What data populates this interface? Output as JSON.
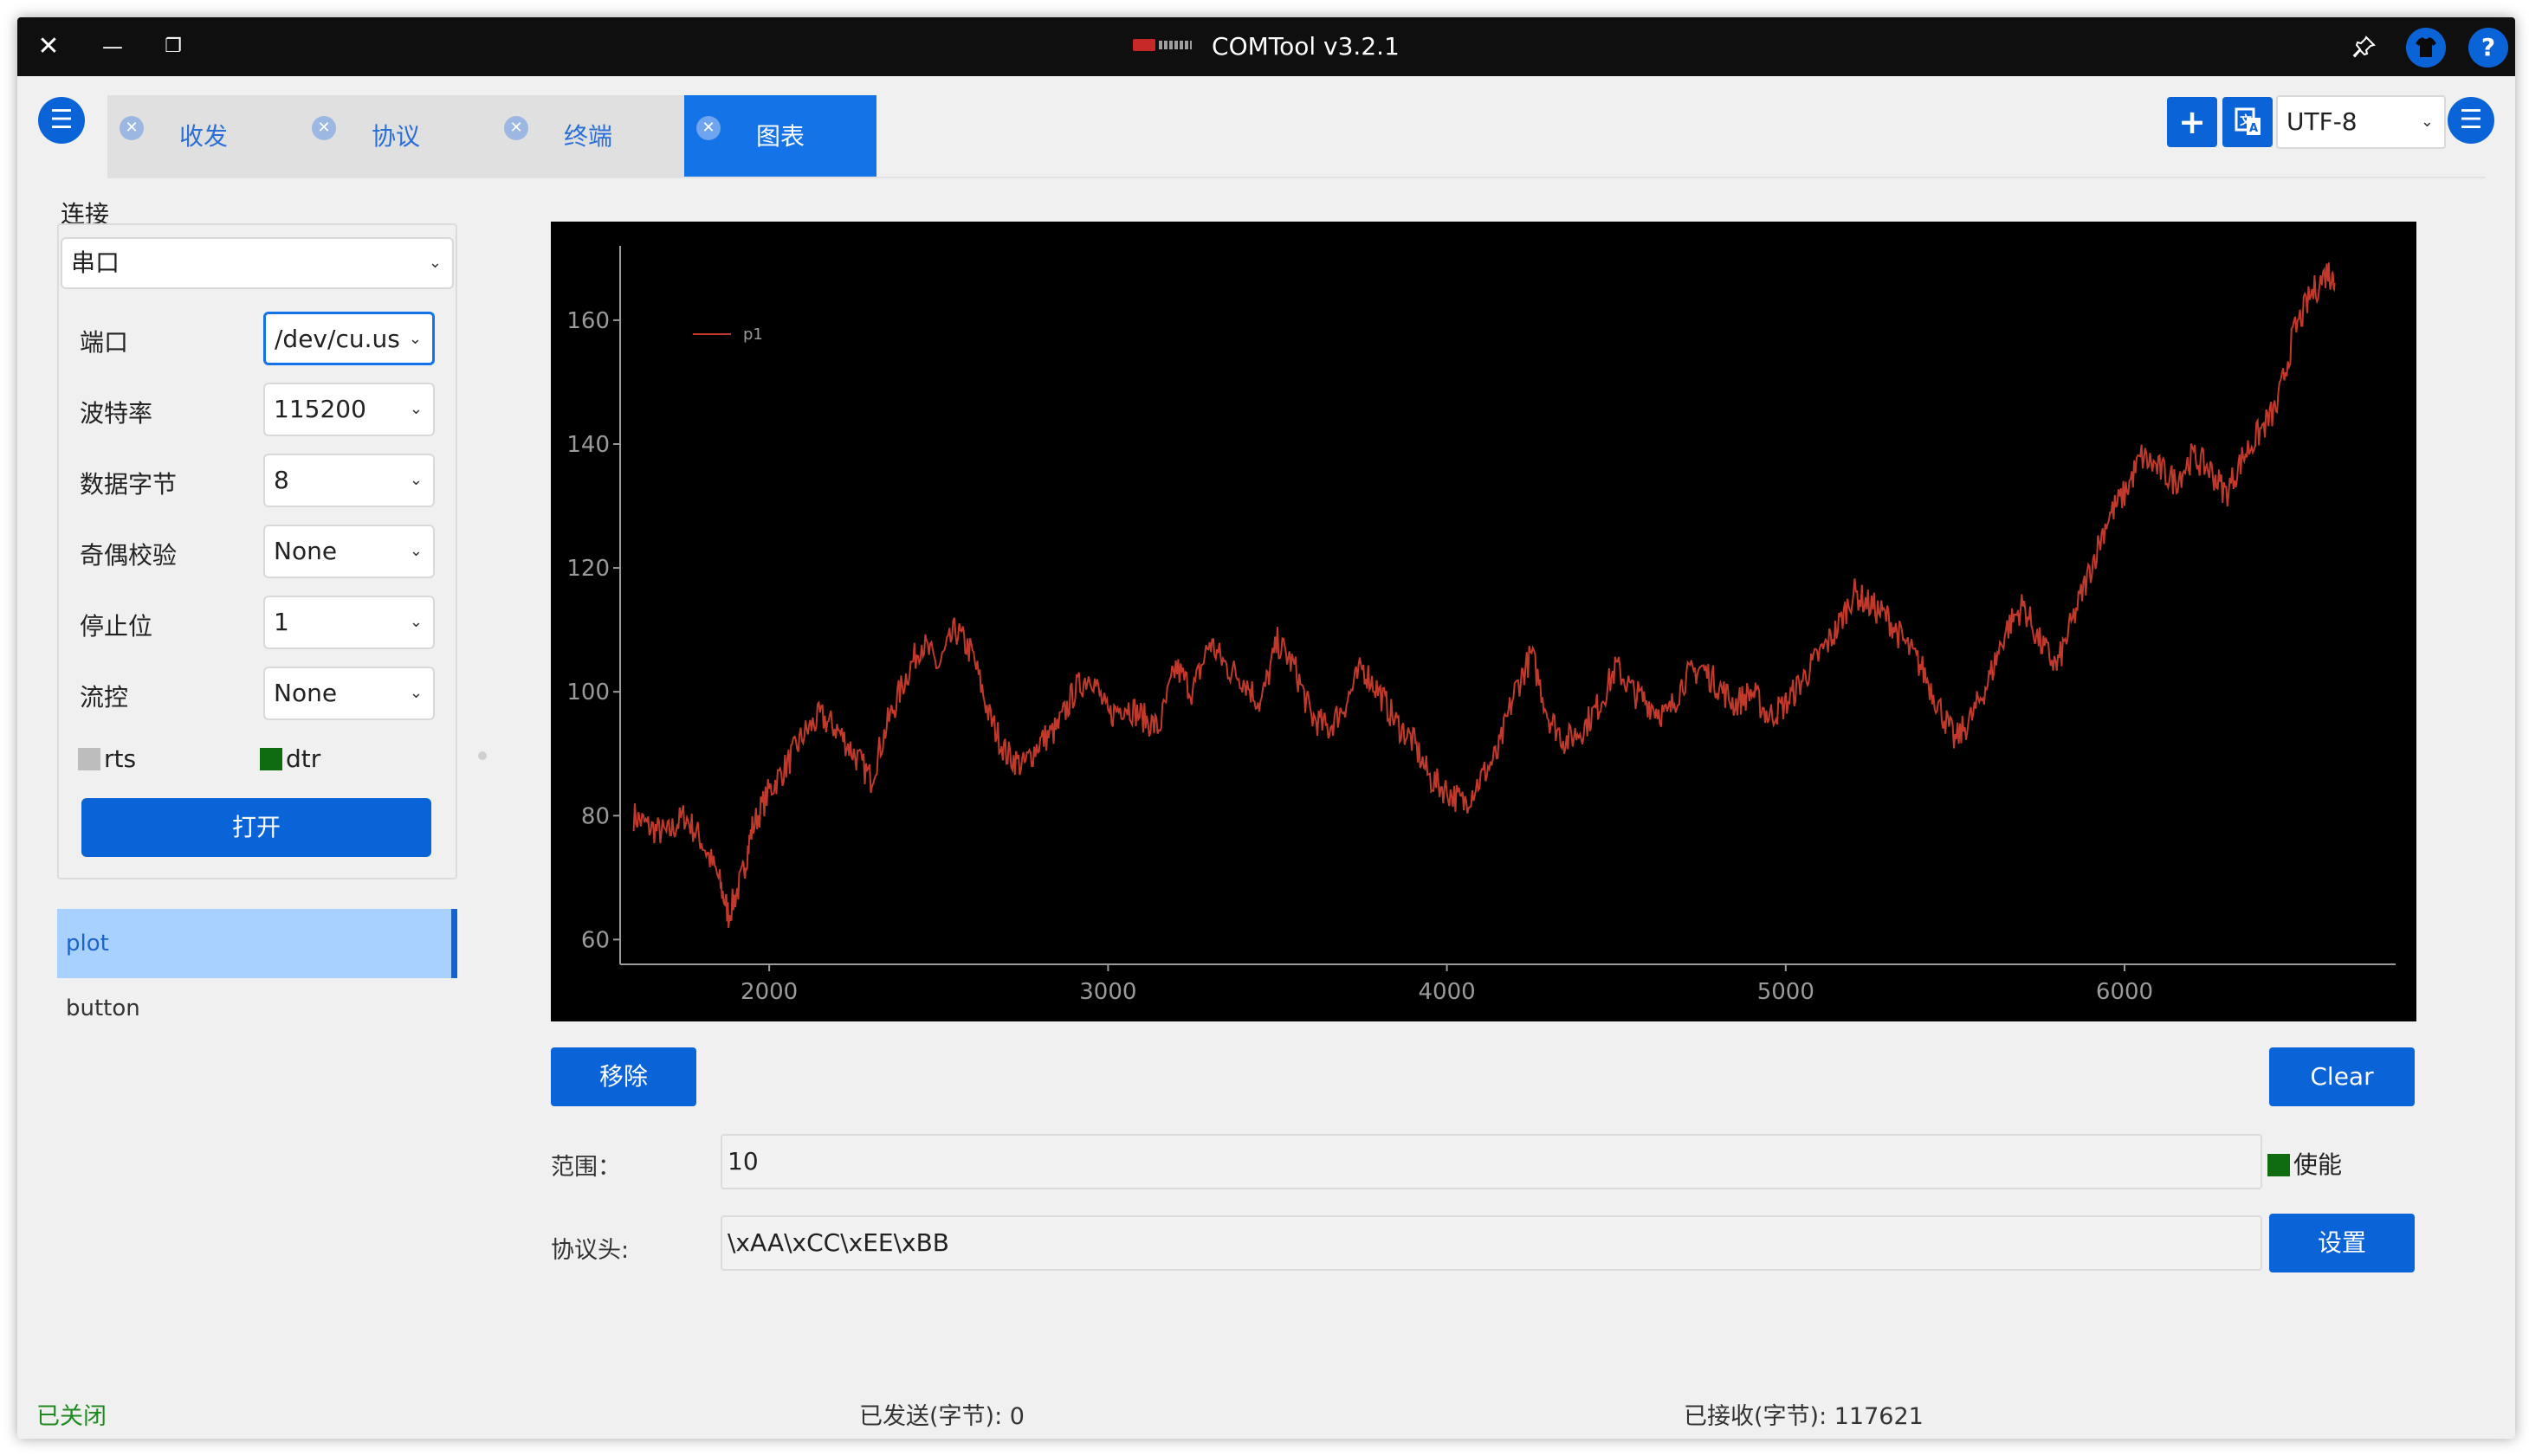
{
  "window": {
    "title": "COMTool v3.2.1",
    "close_glyph": "✕",
    "minimize_glyph": "—",
    "restore_glyph": "❐"
  },
  "titlebar_icons": {
    "pin": "pin-icon",
    "skin": "tshirt-icon",
    "help": "?"
  },
  "tabs": [
    {
      "label": "收发",
      "active": false
    },
    {
      "label": "协议",
      "active": false
    },
    {
      "label": "终端",
      "active": false
    },
    {
      "label": "图表",
      "active": true
    }
  ],
  "toolbar": {
    "add": "+",
    "encoding": "UTF-8"
  },
  "connection": {
    "label": "连接",
    "type": "串口",
    "fields": [
      {
        "label": "端口",
        "value": "/dev/cu.us"
      },
      {
        "label": "波特率",
        "value": "115200"
      },
      {
        "label": "数据字节",
        "value": "8"
      },
      {
        "label": "奇偶校验",
        "value": "None"
      },
      {
        "label": "停止位",
        "value": "1"
      },
      {
        "label": "流控",
        "value": "None"
      }
    ],
    "rts": {
      "label": "rts",
      "checked": false,
      "color": "#bdbdbd"
    },
    "dtr": {
      "label": "dtr",
      "checked": true,
      "color": "#0f6b0f"
    },
    "open_button": "打开"
  },
  "plugins": [
    {
      "label": "plot",
      "selected": true
    },
    {
      "label": "button",
      "selected": false
    }
  ],
  "chart_data": {
    "type": "line",
    "background": "#000000",
    "line_color": "#c0392b",
    "legend": [
      {
        "name": "p1",
        "position": "top-left"
      }
    ],
    "xlim": [
      1560,
      6800
    ],
    "ylim": [
      56,
      172
    ],
    "x_ticks": [
      2000,
      3000,
      4000,
      5000,
      6000
    ],
    "y_ticks": [
      60,
      80,
      100,
      120,
      140,
      160
    ],
    "series": [
      {
        "name": "p1",
        "x": [
          1600,
          1650,
          1700,
          1750,
          1800,
          1850,
          1880,
          1920,
          1950,
          2000,
          2050,
          2100,
          2150,
          2200,
          2250,
          2300,
          2350,
          2400,
          2450,
          2500,
          2550,
          2600,
          2650,
          2700,
          2750,
          2800,
          2850,
          2900,
          2950,
          3000,
          3050,
          3100,
          3150,
          3200,
          3250,
          3300,
          3350,
          3400,
          3450,
          3500,
          3550,
          3600,
          3650,
          3700,
          3750,
          3800,
          3850,
          3900,
          3950,
          4000,
          4050,
          4100,
          4150,
          4200,
          4250,
          4300,
          4350,
          4400,
          4450,
          4500,
          4550,
          4600,
          4650,
          4700,
          4750,
          4800,
          4850,
          4900,
          4950,
          5000,
          5050,
          5100,
          5150,
          5200,
          5250,
          5300,
          5350,
          5400,
          5450,
          5500,
          5550,
          5600,
          5650,
          5700,
          5750,
          5800,
          5850,
          5900,
          5950,
          6000,
          6050,
          6100,
          6150,
          6200,
          6250,
          6300,
          6350,
          6400,
          6450,
          6500,
          6550,
          6600,
          6620
        ],
        "values": [
          80,
          78,
          77,
          80,
          76,
          70,
          64,
          70,
          78,
          84,
          88,
          93,
          96,
          94,
          90,
          86,
          95,
          102,
          108,
          104,
          110,
          106,
          96,
          90,
          88,
          92,
          94,
          100,
          103,
          96,
          98,
          96,
          94,
          104,
          100,
          108,
          104,
          102,
          98,
          108,
          104,
          96,
          94,
          98,
          104,
          100,
          95,
          92,
          86,
          84,
          82,
          86,
          90,
          100,
          106,
          96,
          92,
          94,
          98,
          104,
          100,
          98,
          96,
          102,
          104,
          101,
          98,
          100,
          96,
          98,
          102,
          106,
          110,
          116,
          114,
          112,
          108,
          104,
          98,
          92,
          96,
          102,
          110,
          114,
          108,
          104,
          112,
          120,
          128,
          132,
          138,
          136,
          134,
          138,
          136,
          132,
          138,
          142,
          146,
          158,
          164,
          168,
          166
        ]
      }
    ]
  },
  "plot_controls": {
    "remove_button": "移除",
    "clear_button": "Clear",
    "range_label": "范围：",
    "range_value": "10",
    "enable_label": "使能",
    "header_label": "协议头:",
    "header_value": "\\xAA\\xCC\\xEE\\xBB",
    "set_button": "设置"
  },
  "status": {
    "state": "已关闭",
    "sent": "已发送(字节): 0",
    "received": "已接收(字节): 117621"
  }
}
